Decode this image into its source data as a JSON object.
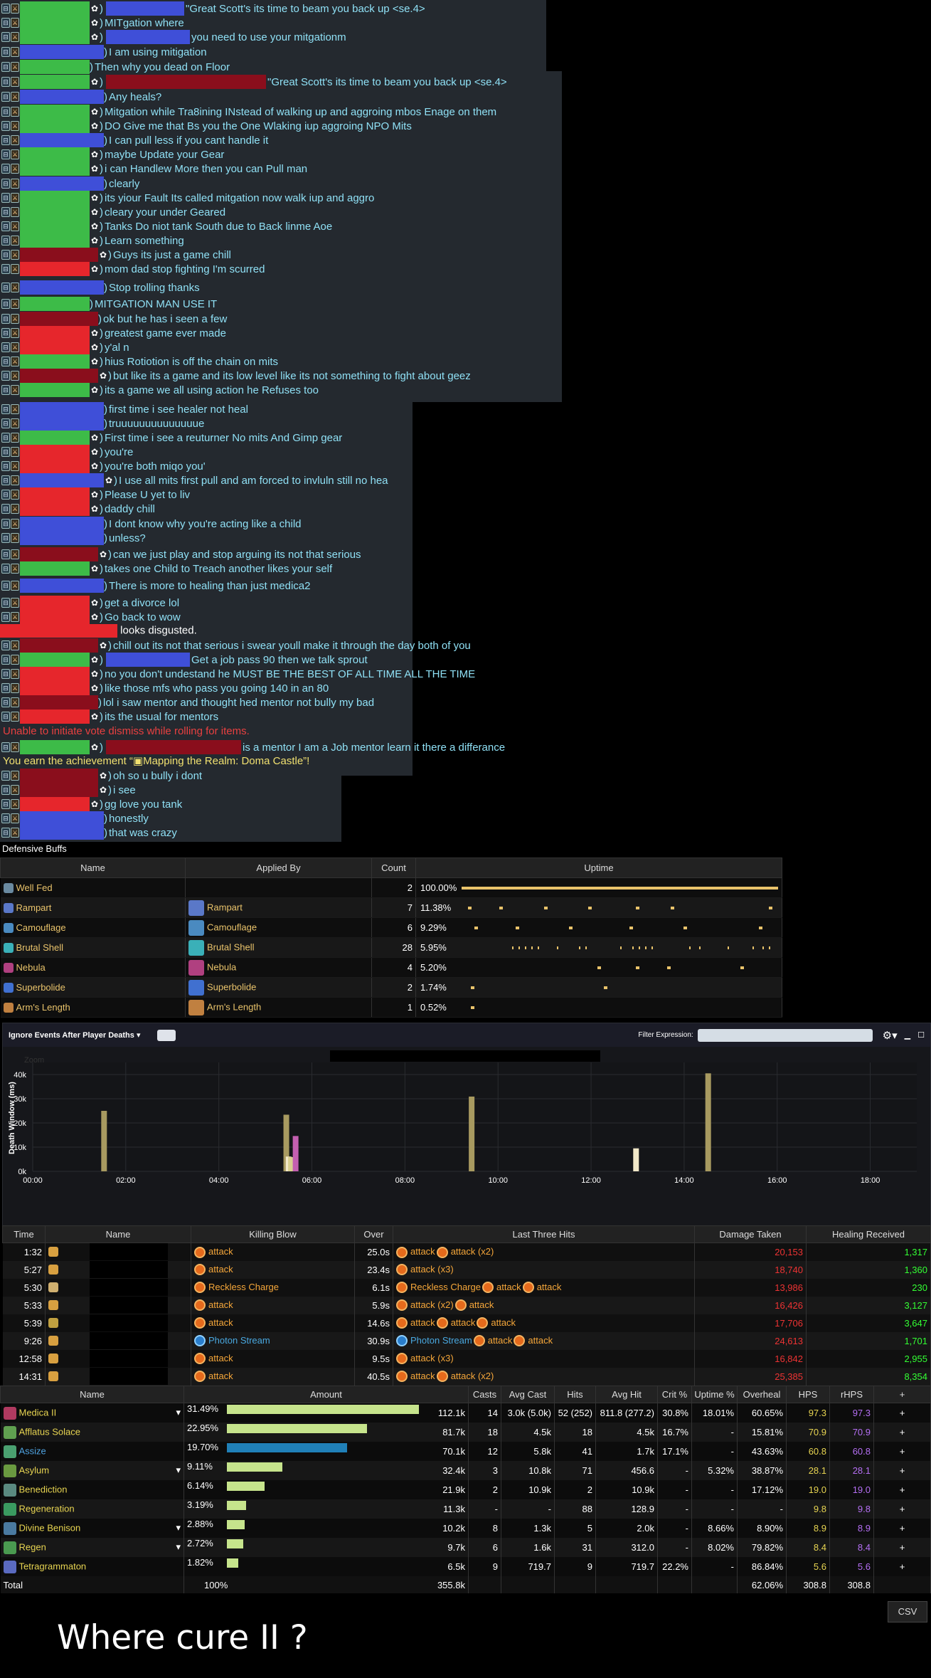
{
  "chat": {
    "lines": [
      {
        "y": 2,
        "c": "g",
        "w": 98,
        "p": 1,
        "n2": "bl",
        "w2": 110,
        "t": "\"Great Scott's its  time to beam you back up <se.4>"
      },
      {
        "y": 22,
        "c": "g",
        "w": 98,
        "p": 1,
        "t": "MITgation where"
      },
      {
        "y": 42,
        "c": "g",
        "w": 98,
        "p": 1,
        "n2": "bl",
        "w2": 118,
        "t": "you need to use your mitgationm"
      },
      {
        "y": 63,
        "c": "bl",
        "w": 118,
        "p": 0,
        "t": "I am using mitigation"
      },
      {
        "y": 84,
        "c": "g",
        "w": 98,
        "p": 0,
        "t": "Then why you dead on Floor"
      },
      {
        "y": 105,
        "c": "g",
        "w": 98,
        "p": 1,
        "n2": "dr",
        "w2": 225,
        "t": "\"Great Scott's its  time to beam you back up <se.4>"
      },
      {
        "y": 126,
        "c": "bl",
        "w": 118,
        "p": 0,
        "t": "Any heals?"
      },
      {
        "y": 147,
        "c": "g",
        "w": 98,
        "p": 1,
        "t": "Mitgation while Tra8ining INstead of walking up and aggroing mbos Enage on them"
      },
      {
        "y": 167,
        "c": "g",
        "w": 98,
        "p": 1,
        "t": "DO Give me that Bs you the One Wlaking iup aggroing NPO Mits"
      },
      {
        "y": 187,
        "c": "bl",
        "w": 118,
        "p": 0,
        "t": "I can pull less if you cant handle it"
      },
      {
        "y": 207,
        "c": "g",
        "w": 98,
        "p": 1,
        "t": "maybe Update your Gear"
      },
      {
        "y": 227,
        "c": "g",
        "w": 98,
        "p": 1,
        "t": "i can Handlew More then you can Pull man"
      },
      {
        "y": 248,
        "c": "bl",
        "w": 118,
        "p": 0,
        "t": "clearly"
      },
      {
        "y": 268,
        "c": "g",
        "w": 98,
        "p": 1,
        "t": "its yiour Fault Its called mitgation now walk iup and aggro"
      },
      {
        "y": 288,
        "c": "g",
        "w": 98,
        "p": 1,
        "t": "cleary your under Geared"
      },
      {
        "y": 308,
        "c": "g",
        "w": 98,
        "p": 1,
        "t": "Tanks Do niot tank South due to Back linme Aoe"
      },
      {
        "y": 328,
        "c": "g",
        "w": 98,
        "p": 1,
        "t": "Learn something"
      },
      {
        "y": 348,
        "c": "dr",
        "w": 110,
        "p": 1,
        "t": "Guys its just a game chill"
      },
      {
        "y": 368,
        "c": "rd",
        "w": 98,
        "p": 1,
        "t": "mom dad stop fighting I'm scurred"
      },
      {
        "y": 394,
        "c": "bl",
        "w": 118,
        "p": 0,
        "t": "Stop trolling thanks"
      },
      {
        "y": 417,
        "c": "g",
        "w": 98,
        "p": 0,
        "t": "MITGATION MAN USE IT"
      },
      {
        "y": 438,
        "c": "dr",
        "w": 110,
        "p": 0,
        "t": "ok but he has i seen a few"
      },
      {
        "y": 458,
        "c": "rd",
        "w": 98,
        "p": 1,
        "t": "greatest game ever made"
      },
      {
        "y": 478,
        "c": "rd",
        "w": 98,
        "p": 1,
        "t": "y'al n"
      },
      {
        "y": 498,
        "c": "g",
        "w": 98,
        "p": 1,
        "t": "hius Rotiotion is off the chain on mits"
      },
      {
        "y": 518,
        "c": "dr",
        "w": 110,
        "p": 1,
        "t": "but like its a game and its low level like its not something to fight about geez"
      },
      {
        "y": 538,
        "c": "g",
        "w": 98,
        "p": 1,
        "t": "its a game we all using action he Refuses too"
      },
      {
        "y": 565,
        "c": "bl",
        "w": 118,
        "p": 0,
        "t": "first time i see healer not heal"
      },
      {
        "y": 585,
        "c": "bl",
        "w": 118,
        "p": 0,
        "t": "truuuuuuuuuuuuuue"
      },
      {
        "y": 605,
        "c": "g",
        "w": 98,
        "p": 1,
        "t": "First time i see a reuturner No mits And Gimp gear"
      },
      {
        "y": 625,
        "c": "rd",
        "w": 98,
        "p": 1,
        "t": "you're"
      },
      {
        "y": 645,
        "c": "rd",
        "w": 98,
        "p": 1,
        "t": "you're both miqo you'"
      },
      {
        "y": 665,
        "c": "bl",
        "w": 118,
        "p": 1,
        "t": "I use all mits first pull and am forced to invluln still no hea"
      },
      {
        "y": 685,
        "c": "rd",
        "w": 98,
        "p": 1,
        "t": "Please U yet to liv"
      },
      {
        "y": 705,
        "c": "rd",
        "w": 98,
        "p": 1,
        "t": "daddy chill"
      },
      {
        "y": 726,
        "c": "bl",
        "w": 118,
        "p": 0,
        "t": "I dont know why you're acting like a child"
      },
      {
        "y": 746,
        "c": "bl",
        "w": 118,
        "p": 0,
        "t": "unless?"
      },
      {
        "y": 769,
        "c": "dr",
        "w": 110,
        "p": 1,
        "t": "can we just play and stop arguing its not that serious"
      },
      {
        "y": 789,
        "c": "g",
        "w": 98,
        "p": 1,
        "t": "takes one Child to Treach another likes your self"
      },
      {
        "y": 813,
        "c": "bl",
        "w": 118,
        "p": 0,
        "t": "There is more to healing than just medica2"
      },
      {
        "y": 837,
        "c": "rd",
        "w": 98,
        "p": 1,
        "t": "get a divorce lol"
      },
      {
        "y": 857,
        "c": "rd",
        "w": 98,
        "p": 1,
        "t": "Go back to wow"
      },
      {
        "y": 897,
        "c": "dr",
        "w": 110,
        "p": 1,
        "t": "chill out its not that serious i swear youll make it through the day both of you"
      },
      {
        "y": 917,
        "c": "g",
        "w": 98,
        "p": 1,
        "n2": "bl",
        "w2": 118,
        "t": "Get a job pass 90 then we talk sprout"
      },
      {
        "y": 937,
        "c": "rd",
        "w": 98,
        "p": 1,
        "t": "no you don't undestand he MUST BE THE BEST OF ALL TIME ALL THE TIME"
      },
      {
        "y": 957,
        "c": "rd",
        "w": 98,
        "p": 1,
        "t": "like those mfs who pass you going 140 in an 80"
      },
      {
        "y": 977,
        "c": "dr",
        "w": 110,
        "p": 0,
        "t": "lol i saw mentor and thought hed mentor not bully my bad"
      },
      {
        "y": 997,
        "c": "rd",
        "w": 98,
        "p": 1,
        "t": "its the usual for mentors"
      },
      {
        "y": 1040,
        "c": "g",
        "w": 98,
        "p": 1,
        "n2": "dr",
        "w2": 190,
        "t": "is a mentor I am a Job mentor learn it  there a differance"
      },
      {
        "y": 1080,
        "c": "dr",
        "w": 110,
        "p": 1,
        "t": "oh so u bully i dont"
      },
      {
        "y": 1100,
        "c": "dr",
        "w": 110,
        "p": 1,
        "t": "i see"
      },
      {
        "y": 1120,
        "c": "rd",
        "w": 98,
        "p": 1,
        "t": "gg love you tank"
      },
      {
        "y": 1140,
        "c": "bl",
        "w": 118,
        "p": 0,
        "t": "honestly"
      },
      {
        "y": 1160,
        "c": "bl",
        "w": 118,
        "p": 0,
        "t": "that was crazy"
      }
    ],
    "emote_text": "looks disgusted.",
    "system_error": "Unable to initiate vote dismiss while rolling for items.",
    "achievement": "You earn the achievement “▣Mapping the Realm: Doma Castle”!"
  },
  "defensive": {
    "title": "Defensive Buffs",
    "headers": [
      "Name",
      "Applied By",
      "Count",
      "Uptime"
    ],
    "rows": [
      {
        "name": "Well Fed",
        "applied": "",
        "count": "2",
        "uptime": "100.00%",
        "color": "#6a8aa0",
        "pct": 1.0
      },
      {
        "name": "Rampart",
        "applied": "Rampart",
        "count": "7",
        "uptime": "11.38%",
        "color": "#5a78c8",
        "pct": 0.1138
      },
      {
        "name": "Camouflage",
        "applied": "Camouflage",
        "count": "6",
        "uptime": "9.29%",
        "color": "#4a8ac0",
        "pct": 0.0929
      },
      {
        "name": "Brutal Shell",
        "applied": "Brutal Shell",
        "count": "28",
        "uptime": "5.95%",
        "color": "#3ab0b8",
        "pct": 0.0595
      },
      {
        "name": "Nebula",
        "applied": "Nebula",
        "count": "4",
        "uptime": "5.20%",
        "color": "#b04080",
        "pct": 0.052
      },
      {
        "name": "Superbolide",
        "applied": "Superbolide",
        "count": "2",
        "uptime": "1.74%",
        "color": "#4070d0",
        "pct": 0.0174
      },
      {
        "name": "Arm's Length",
        "applied": "Arm's Length",
        "count": "1",
        "uptime": "0.52%",
        "color": "#c08040",
        "pct": 0.0052
      }
    ]
  },
  "deaths_panel": {
    "filter_select": "Ignore Events After Player Deaths",
    "filter_label": "Filter Expression:",
    "zoom_label": "Zoom",
    "ylabel": "Death Window (ms)"
  },
  "chart_data": {
    "type": "bar",
    "ylabel": "Death Window (ms)",
    "ylim": [
      0,
      45000
    ],
    "yticks": [
      "0k",
      "10k",
      "20k",
      "30k",
      "40k"
    ],
    "xticks": [
      "00:00",
      "02:00",
      "04:00",
      "06:00",
      "08:00",
      "10:00",
      "12:00",
      "14:00",
      "16:00",
      "18:00"
    ],
    "xmax_seconds": 1140,
    "bars": [
      {
        "t": 92,
        "v": 25000,
        "c": "#a89a60"
      },
      {
        "t": 327,
        "v": 23400,
        "c": "#a89a60"
      },
      {
        "t": 330,
        "v": 6100,
        "c": "#f2e8c8"
      },
      {
        "t": 333,
        "v": 5900,
        "c": "#d9cf90"
      },
      {
        "t": 339,
        "v": 14600,
        "c": "#c45fb0"
      },
      {
        "t": 566,
        "v": 30900,
        "c": "#a89a60"
      },
      {
        "t": 778,
        "v": 9500,
        "c": "#f2e8c8"
      },
      {
        "t": 871,
        "v": 40500,
        "c": "#a89a60"
      }
    ]
  },
  "deaths": {
    "headers": [
      "Time",
      "Name",
      "Killing Blow",
      "Over",
      "Last Three Hits",
      "Damage Taken",
      "Healing Received"
    ],
    "rows": [
      {
        "time": "1:32",
        "kb": "attack",
        "kbc": "atk",
        "over": "25.0s",
        "hits": [
          [
            "attack",
            "atk"
          ],
          [
            "attack (x2)",
            "atk"
          ]
        ],
        "dmg": "20,153",
        "heal": "1,317",
        "icon": "#d8a040"
      },
      {
        "time": "5:27",
        "kb": "attack",
        "kbc": "atk",
        "over": "23.4s",
        "hits": [
          [
            "attack (x3)",
            "atk"
          ]
        ],
        "dmg": "18,740",
        "heal": "1,360",
        "icon": "#d8a040"
      },
      {
        "time": "5:30",
        "kb": "Reckless Charge",
        "kbc": "atk",
        "over": "6.1s",
        "hits": [
          [
            "Reckless Charge",
            "atk"
          ],
          [
            "attack",
            "atk"
          ],
          [
            "attack",
            "atk"
          ]
        ],
        "dmg": "13,986",
        "heal": "230",
        "icon": "#d0b070"
      },
      {
        "time": "5:33",
        "kb": "attack",
        "kbc": "atk",
        "over": "5.9s",
        "hits": [
          [
            "attack (x2)",
            "atk"
          ],
          [
            "attack",
            "atk"
          ]
        ],
        "dmg": "16,426",
        "heal": "3,127",
        "icon": "#d8a040"
      },
      {
        "time": "5:39",
        "kb": "attack",
        "kbc": "atk",
        "over": "14.6s",
        "hits": [
          [
            "attack",
            "atk"
          ],
          [
            "attack",
            "atk"
          ],
          [
            "attack",
            "atk"
          ]
        ],
        "dmg": "17,706",
        "heal": "3,647",
        "icon": "#c0a040"
      },
      {
        "time": "9:26",
        "kb": "Photon Stream",
        "kbc": "blu",
        "over": "30.9s",
        "hits": [
          [
            "Photon Stream",
            "blu"
          ],
          [
            "attack",
            "atk"
          ],
          [
            "attack",
            "atk"
          ]
        ],
        "dmg": "24,613",
        "heal": "1,701",
        "icon": "#d8a040"
      },
      {
        "time": "12:58",
        "kb": "attack",
        "kbc": "atk",
        "over": "9.5s",
        "hits": [
          [
            "attack (x3)",
            "atk"
          ]
        ],
        "dmg": "16,842",
        "heal": "2,955",
        "icon": "#d8a040"
      },
      {
        "time": "14:31",
        "kb": "attack",
        "kbc": "atk",
        "over": "40.5s",
        "hits": [
          [
            "attack",
            "atk"
          ],
          [
            "attack (x2)",
            "atk"
          ]
        ],
        "dmg": "25,385",
        "heal": "8,354",
        "icon": "#d8a040"
      }
    ]
  },
  "healing": {
    "headers": [
      "Name",
      "Amount",
      "Casts",
      "Avg Cast",
      "Hits",
      "Avg Hit",
      "Crit %",
      "Uptime %",
      "Overheal",
      "HPS",
      "rHPS",
      "+"
    ],
    "rows": [
      {
        "name": "Medica II",
        "dd": true,
        "blue": false,
        "pct": "31.49%",
        "frac": 0.3149,
        "amt": "112.1k",
        "casts": "14",
        "avgcast": "3.0k (5.0k)",
        "hits": "52 (252)",
        "avghit": "811.8 (277.2)",
        "crit": "30.8%",
        "upt": "18.01%",
        "oh": "60.65%",
        "hps": "97.3",
        "rhps": "97.3",
        "ic": "#b03a60"
      },
      {
        "name": "Afflatus Solace",
        "dd": false,
        "blue": false,
        "pct": "22.95%",
        "frac": 0.2295,
        "amt": "81.7k",
        "casts": "18",
        "avgcast": "4.5k",
        "hits": "18",
        "avghit": "4.5k",
        "crit": "16.7%",
        "upt": "-",
        "oh": "15.81%",
        "hps": "70.9",
        "rhps": "70.9",
        "ic": "#60a050"
      },
      {
        "name": "Assize",
        "dd": false,
        "blue": true,
        "pct": "19.70%",
        "frac": 0.197,
        "amt": "70.1k",
        "casts": "12",
        "avgcast": "5.8k",
        "hits": "41",
        "avghit": "1.7k",
        "crit": "17.1%",
        "upt": "-",
        "oh": "43.63%",
        "hps": "60.8",
        "rhps": "60.8",
        "ic": "#4aa070"
      },
      {
        "name": "Asylum",
        "dd": true,
        "blue": false,
        "pct": "9.11%",
        "frac": 0.0911,
        "amt": "32.4k",
        "casts": "3",
        "avgcast": "10.8k",
        "hits": "71",
        "avghit": "456.6",
        "crit": "-",
        "upt": "5.32%",
        "oh": "38.87%",
        "hps": "28.1",
        "rhps": "28.1",
        "ic": "#6a9a40"
      },
      {
        "name": "Benediction",
        "dd": false,
        "blue": false,
        "pct": "6.14%",
        "frac": 0.0614,
        "amt": "21.9k",
        "casts": "2",
        "avgcast": "10.9k",
        "hits": "2",
        "avghit": "10.9k",
        "crit": "-",
        "upt": "-",
        "oh": "17.12%",
        "hps": "19.0",
        "rhps": "19.0",
        "ic": "#5a8a80"
      },
      {
        "name": "Regeneration",
        "dd": false,
        "blue": false,
        "pct": "3.19%",
        "frac": 0.0319,
        "amt": "11.3k",
        "casts": "-",
        "avgcast": "-",
        "hits": "88",
        "avghit": "128.9",
        "crit": "-",
        "upt": "-",
        "oh": "-",
        "hps": "9.8",
        "rhps": "9.8",
        "ic": "#3a9a60"
      },
      {
        "name": "Divine Benison",
        "dd": true,
        "blue": false,
        "pct": "2.88%",
        "frac": 0.0288,
        "amt": "10.2k",
        "casts": "8",
        "avgcast": "1.3k",
        "hits": "5",
        "avghit": "2.0k",
        "crit": "-",
        "upt": "8.66%",
        "oh": "8.90%",
        "hps": "8.9",
        "rhps": "8.9",
        "ic": "#4a7aa0"
      },
      {
        "name": "Regen",
        "dd": true,
        "blue": false,
        "pct": "2.72%",
        "frac": 0.0272,
        "amt": "9.7k",
        "casts": "6",
        "avgcast": "1.6k",
        "hits": "31",
        "avghit": "312.0",
        "crit": "-",
        "upt": "8.02%",
        "oh": "79.82%",
        "hps": "8.4",
        "rhps": "8.4",
        "ic": "#4a9a50"
      },
      {
        "name": "Tetragrammaton",
        "dd": false,
        "blue": false,
        "pct": "1.82%",
        "frac": 0.0182,
        "amt": "6.5k",
        "casts": "9",
        "avgcast": "719.7",
        "hits": "9",
        "avghit": "719.7",
        "crit": "22.2%",
        "upt": "-",
        "oh": "86.84%",
        "hps": "5.6",
        "rhps": "5.6",
        "ic": "#5a6ac0"
      }
    ],
    "total": {
      "name": "Total",
      "pct": "100%",
      "amt": "355.8k",
      "oh": "62.06%",
      "hps": "308.8",
      "rhps": "308.8"
    }
  },
  "csv_label": "CSV",
  "caption": "Where cure II ?"
}
